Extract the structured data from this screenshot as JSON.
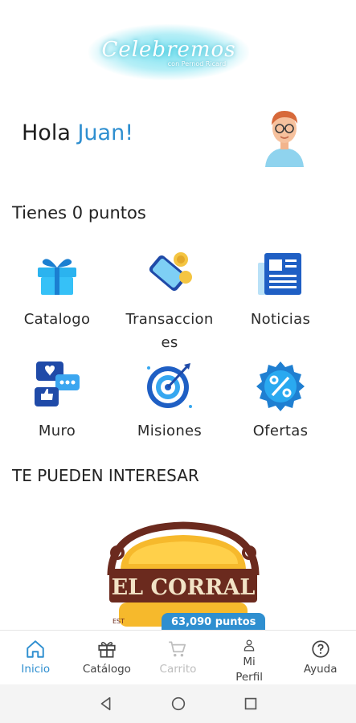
{
  "brand": {
    "title": "Celebremos",
    "subtitle": "con Pernod Ricard"
  },
  "header": {
    "greeting": "Hola",
    "user_name": "Juan!"
  },
  "points": {
    "text": "Tienes 0 puntos"
  },
  "menu": [
    {
      "label": "Catalogo",
      "icon": "gift-icon"
    },
    {
      "label": "Transacciones",
      "icon": "phone-coins-icon"
    },
    {
      "label": "Noticias",
      "icon": "newspaper-icon"
    },
    {
      "label": "Muro",
      "icon": "chat-bubbles-icon"
    },
    {
      "label": "Misiones",
      "icon": "target-icon"
    },
    {
      "label": "Ofertas",
      "icon": "percent-badge-icon"
    }
  ],
  "recommendations": {
    "title": "TE PUEDEN INTERESAR",
    "items": [
      {
        "brand": "EL CORRAL",
        "est": "EST",
        "points": "63,090 puntos"
      }
    ]
  },
  "tabbar": {
    "items": [
      {
        "label": "Inicio",
        "icon": "home-icon",
        "state": "active"
      },
      {
        "label": "Catálogo",
        "icon": "gift-icon",
        "state": "normal"
      },
      {
        "label": "Carrito",
        "icon": "cart-icon",
        "state": "disabled"
      },
      {
        "label": "Mi Perfil",
        "icon": "user-icon",
        "state": "normal"
      },
      {
        "label": "Ayuda",
        "icon": "help-icon",
        "state": "normal"
      }
    ]
  },
  "system_nav": {
    "icons": [
      "back-icon",
      "home-circle-icon",
      "recents-icon"
    ]
  },
  "colors": {
    "accent": "#2f8fd0",
    "disabled": "#bdbdbd",
    "text": "#222222"
  }
}
